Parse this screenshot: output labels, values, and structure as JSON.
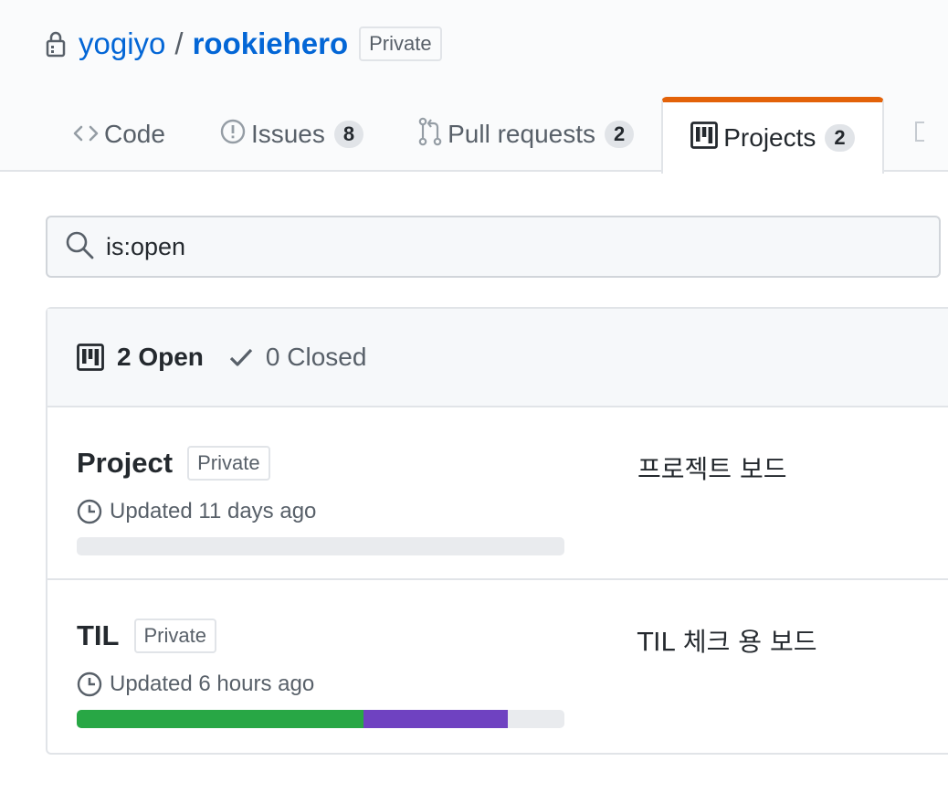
{
  "repo": {
    "owner": "yogiyo",
    "separator": "/",
    "name": "rookiehero",
    "visibility": "Private"
  },
  "tabs": [
    {
      "label": "Code",
      "icon": "code-icon",
      "selected": false
    },
    {
      "label": "Issues",
      "icon": "issue-opened-icon",
      "count": "8",
      "selected": false
    },
    {
      "label": "Pull requests",
      "icon": "git-pull-request-icon",
      "count": "2",
      "selected": false
    },
    {
      "label": "Projects",
      "icon": "project-icon",
      "count": "2",
      "selected": true
    }
  ],
  "colors": {
    "link": "#0366d6",
    "selected_tab_accent": "#e36209",
    "progress_done": "#28a745",
    "progress_in_progress": "#6f42c1",
    "progress_todo": "#e9ebee"
  },
  "search": {
    "value": "is:open"
  },
  "states": {
    "open_label": "2 Open",
    "closed_label": "0 Closed"
  },
  "projects": [
    {
      "name": "Project",
      "visibility": "Private",
      "updated": "Updated 11 days ago",
      "description": "프로젝트 보드",
      "progress": {
        "done": 0,
        "in_progress": 0
      }
    },
    {
      "name": "TIL",
      "visibility": "Private",
      "updated": "Updated 6 hours ago",
      "description": "TIL 체크 용 보드",
      "progress": {
        "done": 0.588,
        "in_progress": 0.296
      }
    }
  ]
}
